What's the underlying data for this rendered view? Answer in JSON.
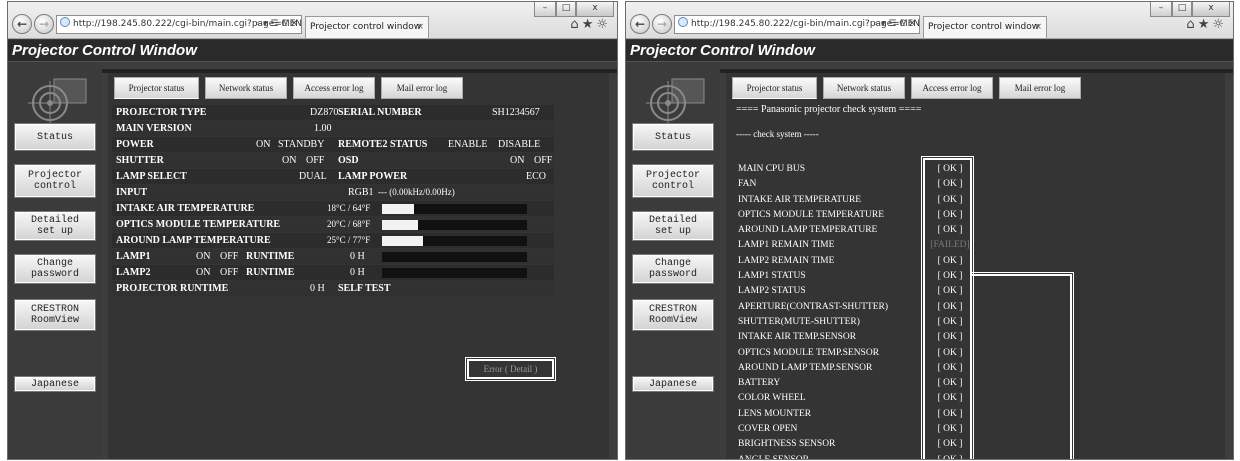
{
  "browser": {
    "url": "http://198.245.80.222/cgi-bin/main.cgi?page=MENU_",
    "url_controls": "⌕ ▾ ☰ C ✕",
    "tab_title": "Projector control window",
    "tab_close": "×",
    "minimize": "–",
    "maximize": "□",
    "close": "x",
    "home_icon": "⌂",
    "star_icon": "★",
    "gear_icon": "☼",
    "back": "←",
    "forward": "→"
  },
  "page": {
    "title": "Projector Control Window"
  },
  "sidebar": {
    "items": [
      {
        "label": "Status"
      },
      {
        "label": "Projector\ncontrol"
      },
      {
        "label": "Detailed\nset up"
      },
      {
        "label": "Change\npassword"
      },
      {
        "label": "CRESTRON\nRoomView"
      },
      {
        "label": "Japanese"
      }
    ]
  },
  "tabs": [
    {
      "label": "Projector status"
    },
    {
      "label": "Network status"
    },
    {
      "label": "Access error log"
    },
    {
      "label": "Mail error log"
    }
  ],
  "status": {
    "projector_type_label": "PROJECTOR TYPE",
    "projector_type": "DZ870",
    "serial_label": "SERIAL NUMBER",
    "serial": "SH1234567",
    "main_version_label": "MAIN VERSION",
    "main_version": "1.00",
    "power_label": "POWER",
    "power_on": "ON",
    "power_standby": "STANDBY",
    "remote2_label": "REMOTE2 STATUS",
    "remote2_enable": "ENABLE",
    "remote2_disable": "DISABLE",
    "shutter_label": "SHUTTER",
    "shutter_on": "ON",
    "shutter_off": "OFF",
    "osd_label": "OSD",
    "osd_on": "ON",
    "osd_off": "OFF",
    "lamp_select_label": "LAMP SELECT",
    "lamp_select": "DUAL",
    "lamp_power_label": "LAMP POWER",
    "lamp_power": "ECO",
    "input_label": "INPUT",
    "input": "RGB1",
    "input_signal": "--- (0.00kHz/0.00Hz)",
    "intake_label": "INTAKE AIR TEMPERATURE",
    "intake_value": "18°C / 64°F",
    "intake_fraction": 0.22,
    "optics_label": "OPTICS MODULE TEMPERATURE",
    "optics_value": "20°C / 68°F",
    "optics_fraction": 0.25,
    "around_label": "AROUND LAMP TEMPERATURE",
    "around_value": "25°C / 77°F",
    "around_fraction": 0.28,
    "lamp1_label": "LAMP1",
    "lamp1_on": "ON",
    "lamp1_off": "OFF",
    "lamp1_runtime_label": "RUNTIME",
    "lamp1_runtime": "0 H",
    "lamp2_label": "LAMP2",
    "lamp2_on": "ON",
    "lamp2_off": "OFF",
    "lamp2_runtime_label": "RUNTIME",
    "lamp2_runtime": "0 H",
    "proj_runtime_label": "PROJECTOR RUNTIME",
    "proj_runtime": "0 H",
    "self_test_label": "SELF TEST",
    "self_test_button": "Error ( Detail )"
  },
  "check": {
    "heading": "==== Panasonic projector check system ====",
    "subheading": "----- check system -----",
    "items": [
      {
        "name": "MAIN CPU BUS",
        "result": "[ OK ]"
      },
      {
        "name": "FAN",
        "result": "[ OK ]"
      },
      {
        "name": "INTAKE AIR TEMPERATURE",
        "result": "[ OK ]"
      },
      {
        "name": "OPTICS MODULE TEMPERATURE",
        "result": "[ OK ]"
      },
      {
        "name": "AROUND LAMP TEMPERATURE",
        "result": "[ OK ]"
      },
      {
        "name": "LAMP1 REMAIN TIME",
        "result": "[FAILED]"
      },
      {
        "name": "LAMP2 REMAIN TIME",
        "result": "[ OK ]"
      },
      {
        "name": "LAMP1 STATUS",
        "result": "[ OK ]"
      },
      {
        "name": "LAMP2 STATUS",
        "result": "[ OK ]"
      },
      {
        "name": "APERTURE(CONTRAST-SHUTTER)",
        "result": "[ OK ]"
      },
      {
        "name": "SHUTTER(MUTE-SHUTTER)",
        "result": "[ OK ]"
      },
      {
        "name": "INTAKE AIR TEMP.SENSOR",
        "result": "[ OK ]"
      },
      {
        "name": "OPTICS MODULE TEMP.SENSOR",
        "result": "[ OK ]"
      },
      {
        "name": "AROUND LAMP TEMP.SENSOR",
        "result": "[ OK ]"
      },
      {
        "name": "BATTERY",
        "result": "[ OK ]"
      },
      {
        "name": "COLOR WHEEL",
        "result": "[ OK ]"
      },
      {
        "name": "LENS MOUNTER",
        "result": "[ OK ]"
      },
      {
        "name": "COVER OPEN",
        "result": "[ OK ]"
      },
      {
        "name": "BRIGHTNESS SENSOR",
        "result": "[ OK ]"
      },
      {
        "name": "ANGLE SENSOR",
        "result": "[ OK ]"
      }
    ]
  }
}
